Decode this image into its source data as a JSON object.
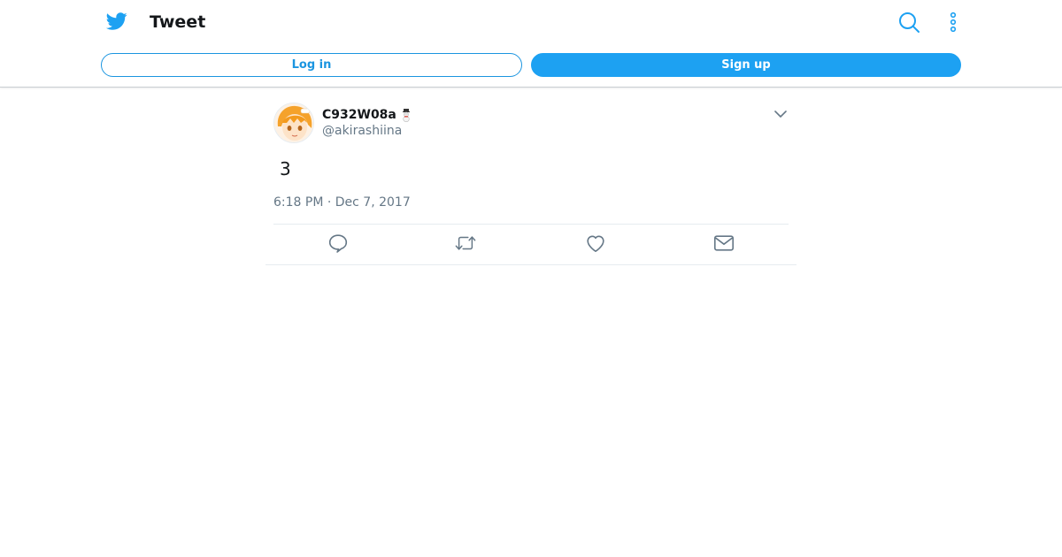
{
  "header": {
    "title": "Tweet",
    "login_label": "Log in",
    "signup_label": "Sign up",
    "icons": [
      "twitter-bird-icon",
      "search-icon",
      "more-vertical-icon"
    ]
  },
  "tweet": {
    "display_name": "C932W08a",
    "handle": "@akirashiina",
    "text": "3",
    "timestamp": "6:18 PM · Dec 7, 2017",
    "actions": [
      "reply-icon",
      "retweet-icon",
      "like-icon",
      "direct-message-icon"
    ]
  },
  "colors": {
    "brand_blue": "#1da1f2",
    "text_primary": "#14171a",
    "text_secondary": "#657786",
    "divider": "#e6ecf0"
  }
}
